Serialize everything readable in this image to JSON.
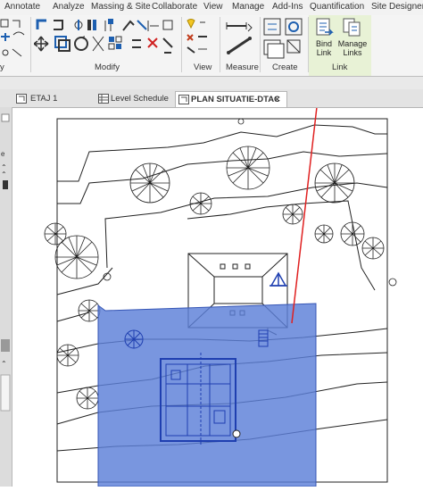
{
  "menu": [
    "Annotate",
    "Analyze",
    "Massing & Site",
    "Collaborate",
    "View",
    "Manage",
    "Add-Ins",
    "Quantification",
    "Site Designer"
  ],
  "ribbon": {
    "groups": {
      "left_partial": "y",
      "modify": "Modify",
      "view": "View",
      "measure": "Measure",
      "create": "Create",
      "link": "Link"
    },
    "bind_link": [
      "Bind",
      "Link"
    ],
    "manage_links": [
      "Manage",
      "Links"
    ],
    "link_accent_color": "#e8f2d6"
  },
  "tabs": [
    {
      "label": "ETAJ 1"
    },
    {
      "label": "Level Schedule"
    },
    {
      "label": "PLAN SITUATIE-DTAC"
    }
  ],
  "tab_close_glyph": "×",
  "colors": {
    "link_selection": "#5b7fd8",
    "arrow": "#e02020"
  }
}
